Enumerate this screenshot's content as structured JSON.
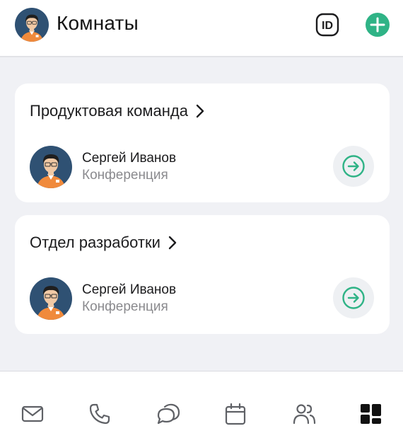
{
  "header": {
    "title": "Комнаты",
    "id_button_label": "ID",
    "add_button_icon": "plus-icon",
    "accent_color": "#2fb386"
  },
  "rooms": [
    {
      "title": "Продуктовая команда",
      "entry": {
        "name": "Сергей Иванов",
        "subtitle": "Конференция"
      }
    },
    {
      "title": "Отдел разработки",
      "entry": {
        "name": "Сергей Иванов",
        "subtitle": "Конференция"
      }
    }
  ],
  "bottom_nav": [
    {
      "icon": "mail-icon",
      "active": false
    },
    {
      "icon": "phone-icon",
      "active": false
    },
    {
      "icon": "chat-icon",
      "active": false
    },
    {
      "icon": "calendar-icon",
      "active": false
    },
    {
      "icon": "contacts-icon",
      "active": false
    },
    {
      "icon": "rooms-icon",
      "active": true
    }
  ]
}
